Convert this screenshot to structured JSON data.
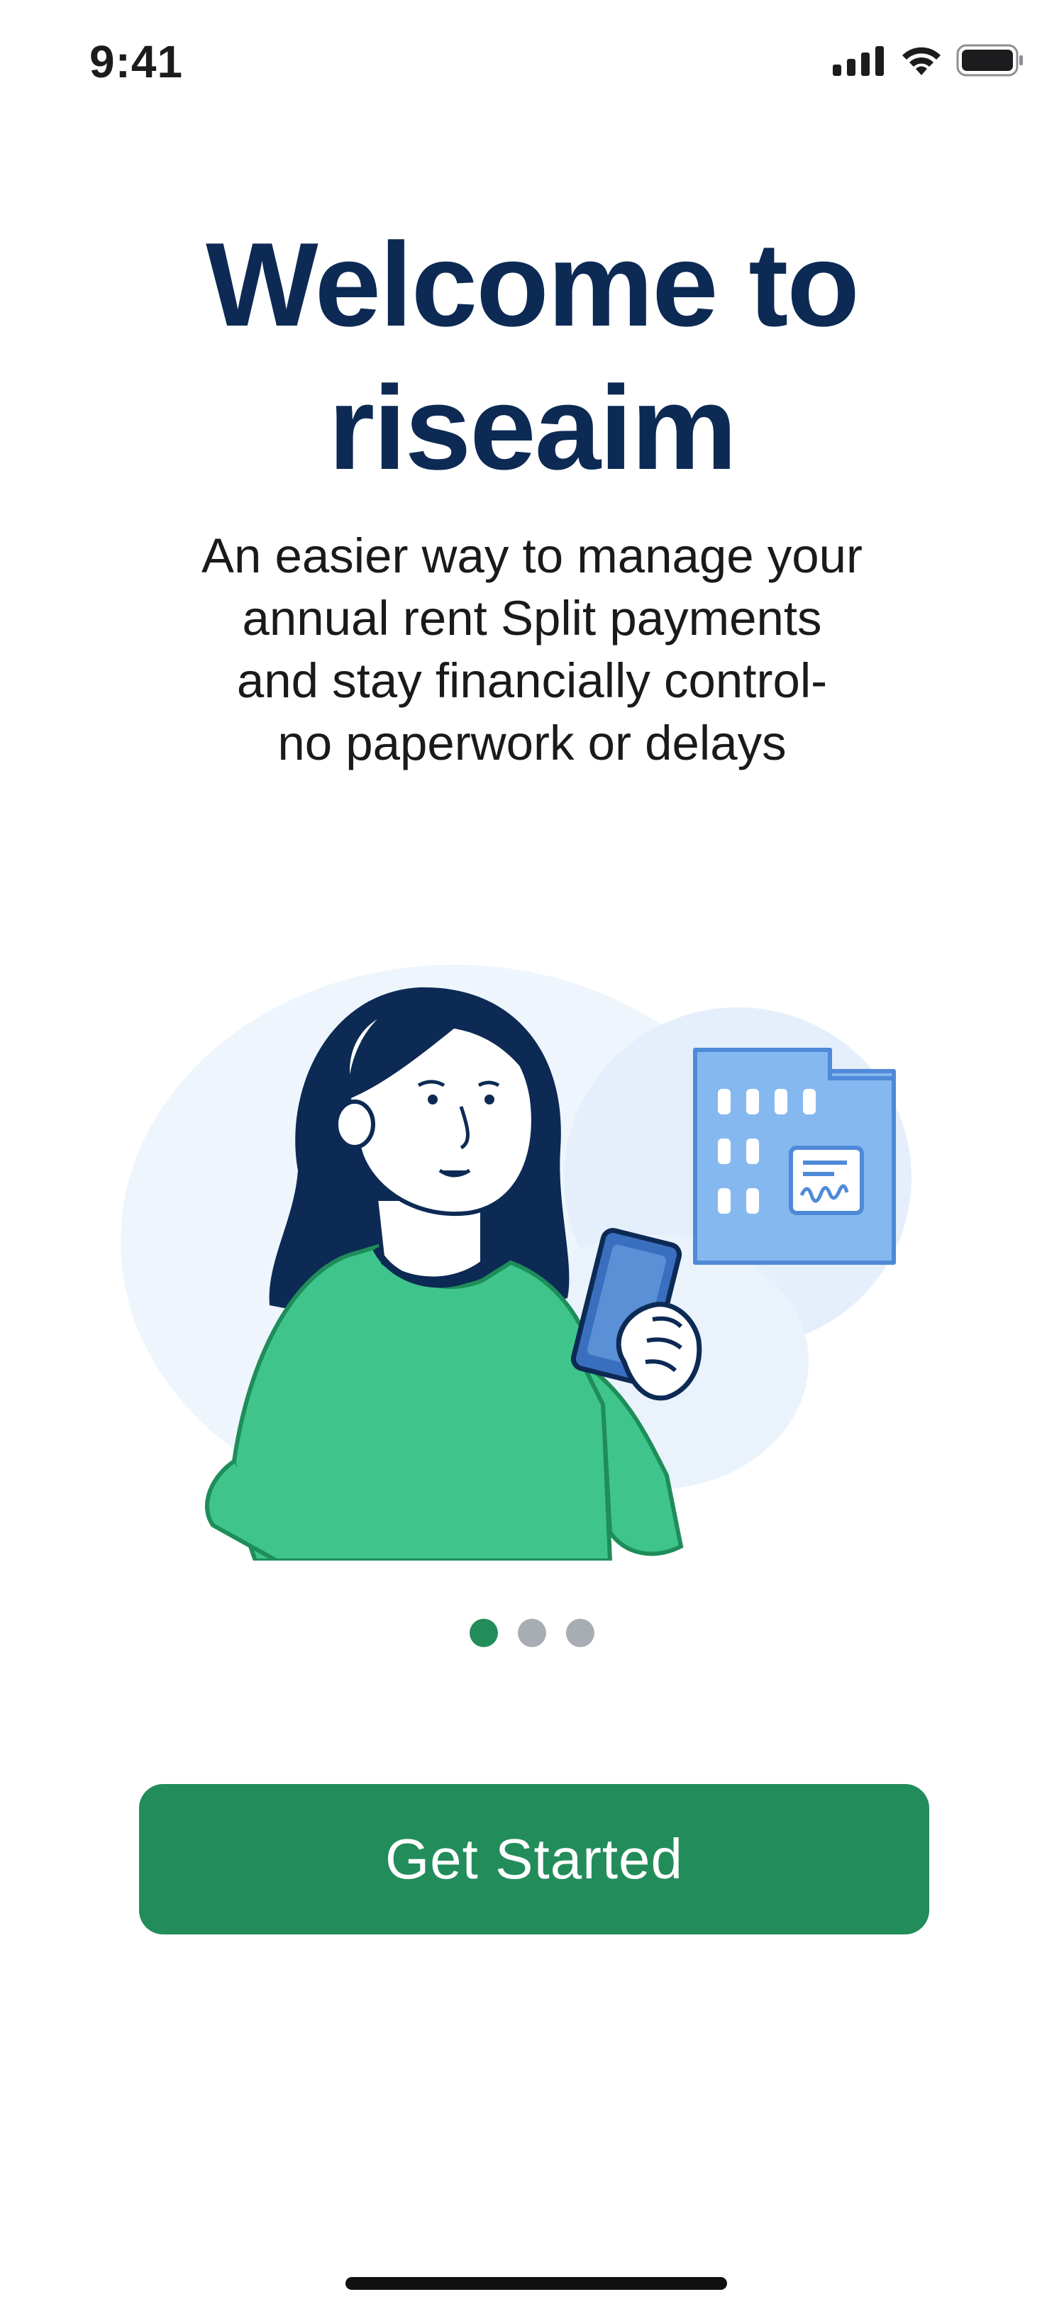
{
  "status_bar": {
    "time": "9:41",
    "icons": [
      "cellular-signal-icon",
      "wifi-icon",
      "battery-icon"
    ]
  },
  "onboarding": {
    "title_lines": [
      "Welcome to",
      "riseaim"
    ],
    "subtitle_lines": [
      "An easier way to manage your",
      "annual rent Split payments",
      "and stay financially control-",
      "no paperwork or delays"
    ],
    "illustration": "woman-holding-phone-with-document-illustration",
    "pager": {
      "total": 3,
      "active_index": 0
    },
    "cta_label": "Get Started"
  },
  "colors": {
    "title": "#0c2a54",
    "accent": "#238c5b",
    "inactive_dot": "#a7adb3",
    "shirt": "#3fc58c",
    "document": "#86b8f0"
  }
}
